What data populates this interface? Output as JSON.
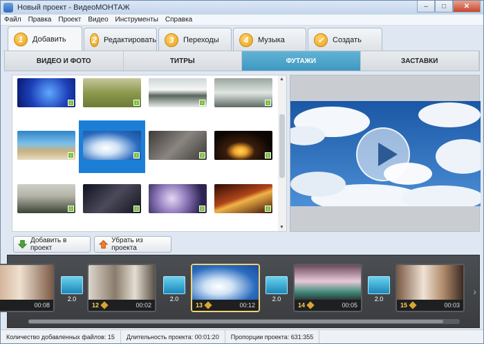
{
  "window": {
    "title": "Новый проект - ВидеоМОНТАЖ",
    "minimize": "‒",
    "maximize": "□",
    "close": "✕"
  },
  "menu": [
    "Файл",
    "Правка",
    "Проект",
    "Видео",
    "Инструменты",
    "Справка"
  ],
  "steps": [
    {
      "num": "1",
      "label": "Добавить",
      "active": true
    },
    {
      "num": "2",
      "label": "Редактировать"
    },
    {
      "num": "3",
      "label": "Переходы"
    },
    {
      "num": "4",
      "label": "Музыка"
    },
    {
      "num": "✓",
      "label": "Создать"
    }
  ],
  "subtabs": [
    {
      "label": "ВИДЕО И ФОТО"
    },
    {
      "label": "ТИТРЫ"
    },
    {
      "label": "ФУТАЖИ",
      "active": true
    },
    {
      "label": "ЗАСТАВКИ"
    }
  ],
  "gallery": {
    "items": [
      "blue-particles",
      "grass-field",
      "ocean-shore",
      "snowy-field",
      "beach-coast",
      "sky-clouds",
      "sand-surface",
      "candle",
      "foggy-hills",
      "starry-sky",
      "bokeh-lights",
      "golden-waves"
    ],
    "selected_index": 5
  },
  "actions": {
    "add": "Добавить в проект",
    "remove": "Убрать из проекта"
  },
  "timeline": {
    "clips": [
      {
        "num": "",
        "dur": "00:08"
      },
      {
        "num": "12",
        "dur": "00:02"
      },
      {
        "num": "13",
        "dur": "00:12",
        "active": true
      },
      {
        "num": "14",
        "dur": "00:05"
      },
      {
        "num": "15",
        "dur": "00:03"
      }
    ],
    "transitions": [
      "2.0",
      "2.0",
      "2.0",
      "2.0",
      "2.0"
    ],
    "prev_arrow": "‹",
    "next_arrow": "›"
  },
  "status": {
    "files": "Количество добавленных файлов: 15",
    "duration": "Длительность проекта:   00:01:20",
    "ratio": "Пропорции проекта:   631:355"
  }
}
